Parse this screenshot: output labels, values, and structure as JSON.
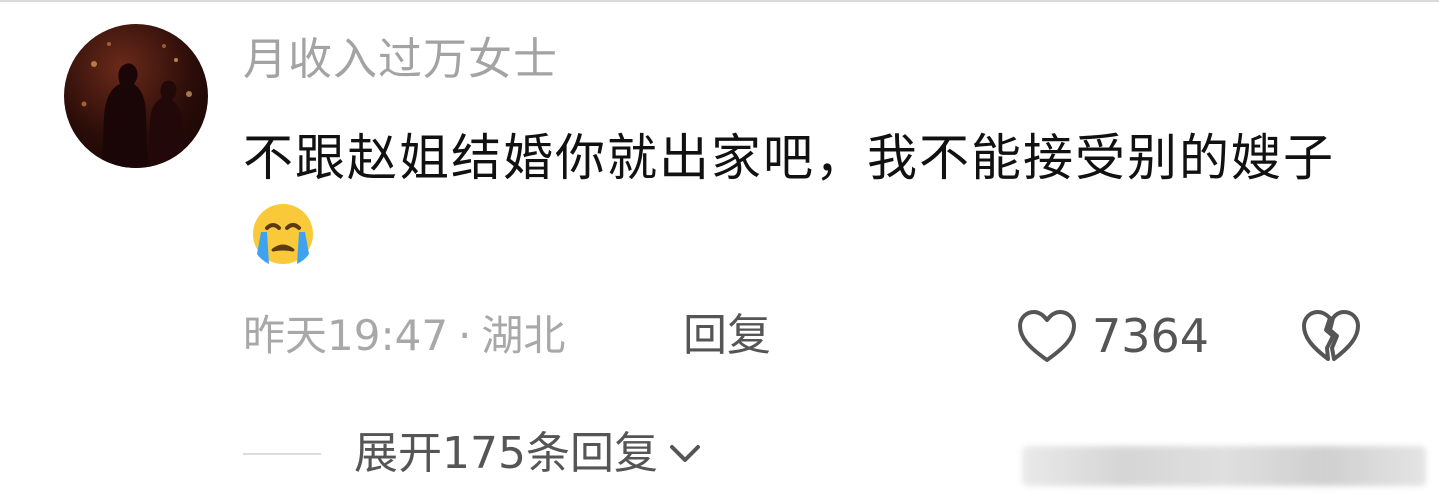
{
  "comment": {
    "username": "月收入过万女士",
    "text": "不跟赵姐结婚你就出家吧，我不能接受别的嫂子",
    "emoji": "loudly-crying-face",
    "time": "昨天19:47",
    "separator": "·",
    "location": "湖北",
    "reply_label": "回复",
    "like_count": "7364",
    "like_icon": "heart-outline-icon",
    "dislike_icon": "broken-heart-icon"
  },
  "replies": {
    "expand_label": "展开175条回复",
    "expand_icon": "chevron-down-icon"
  },
  "colors": {
    "username": "#a3a3a3",
    "text": "#111111",
    "meta": "#a8a8a8",
    "action": "#555555",
    "emoji_face": "#f9c93a",
    "emoji_tears": "#3fa2f0"
  }
}
